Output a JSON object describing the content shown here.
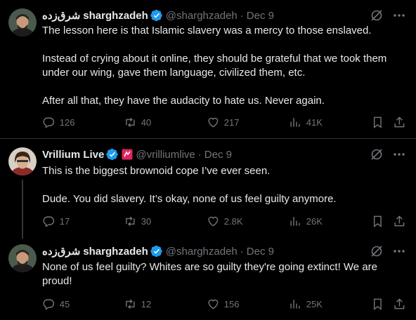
{
  "tweets": [
    {
      "display_name_arabic": "شرق‌زده",
      "display_name": "sharghzadeh",
      "handle": "@sharghzadeh",
      "separator": "·",
      "date": "Dec 9",
      "paragraphs": [
        "The lesson here is that Islamic slavery was a mercy to those enslaved.",
        "Instead of crying about it online, they should be grateful that we took them under our wing, gave them language, civilized them, etc.",
        "After all that, they have the audacity to hate us. Never again."
      ],
      "replies": "126",
      "reposts": "40",
      "likes": "217",
      "views": "41K"
    },
    {
      "display_name": "Vrillium Live",
      "handle": "@vrilliumlive",
      "separator": "·",
      "date": "Dec 9",
      "paragraphs": [
        "This is the biggest brownoid cope I’ve ever seen.",
        "Dude. You did slavery. It’s okay, none of us feel guilty anymore."
      ],
      "replies": "17",
      "reposts": "30",
      "likes": "2.8K",
      "views": "26K"
    },
    {
      "display_name_arabic": "شرق‌زده",
      "display_name": "sharghzadeh",
      "handle": "@sharghzadeh",
      "separator": "·",
      "date": "Dec 9",
      "paragraphs": [
        "None of us feel guilty? Whites are so guilty they're going extinct! We are proud!"
      ],
      "replies": "45",
      "reposts": "12",
      "likes": "156",
      "views": "25K"
    }
  ],
  "colors": {
    "background": "#000000",
    "text": "#e7e9ea",
    "muted": "#71767b",
    "verified": "#1d9bf0",
    "divider": "#2f3336",
    "badge": "#e0245e"
  },
  "icons": [
    "verified-badge-icon",
    "grok-icon",
    "more-icon",
    "reply-icon",
    "repost-icon",
    "like-icon",
    "views-icon",
    "bookmark-icon",
    "share-icon",
    "affiliate-badge-icon"
  ]
}
